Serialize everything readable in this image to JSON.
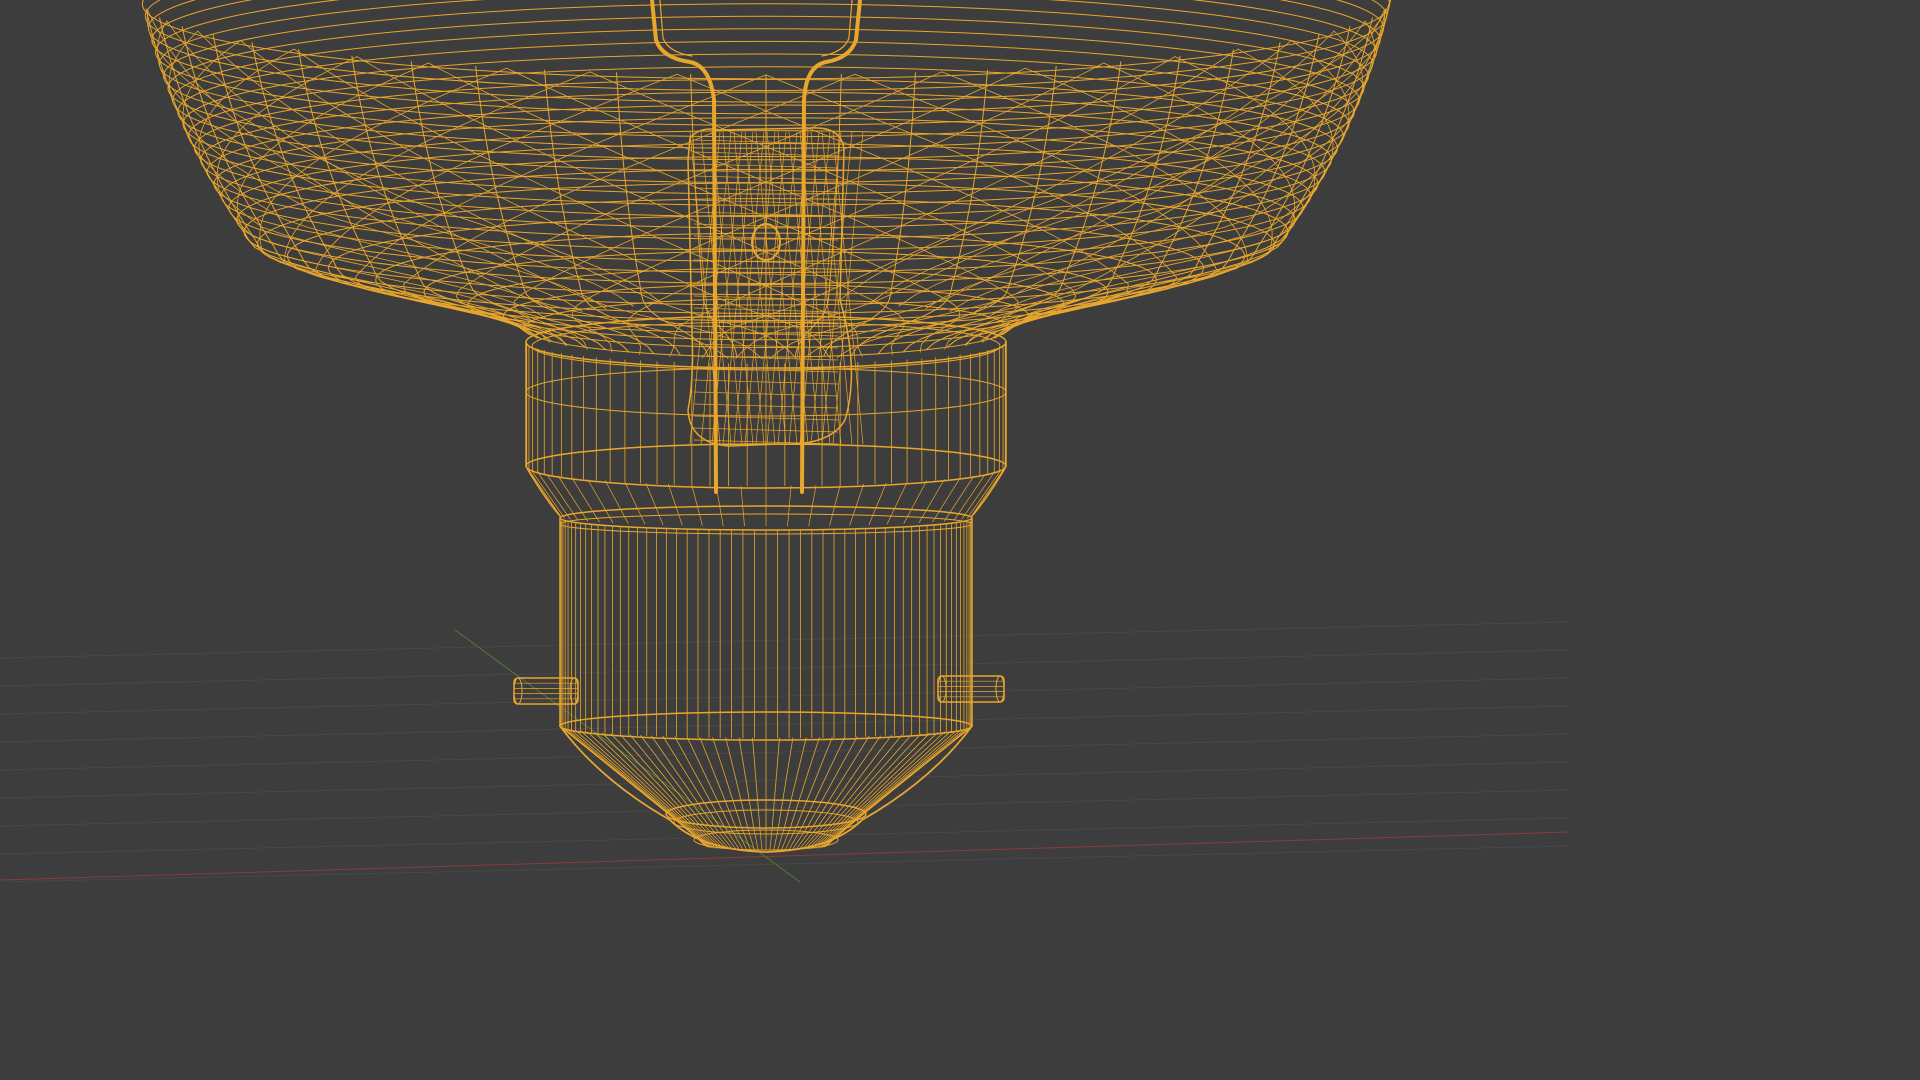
{
  "viewport": {
    "background_color": "#3d3d3d",
    "wire_color": "#e8a62c",
    "wire_color_dark": "#b67a1a",
    "grid_color": "#474747",
    "x_axis_color": "#8a3b3b",
    "y_axis_color": "#4f7a3a"
  },
  "object": {
    "name_icon": "light-bulb-wireframe"
  }
}
